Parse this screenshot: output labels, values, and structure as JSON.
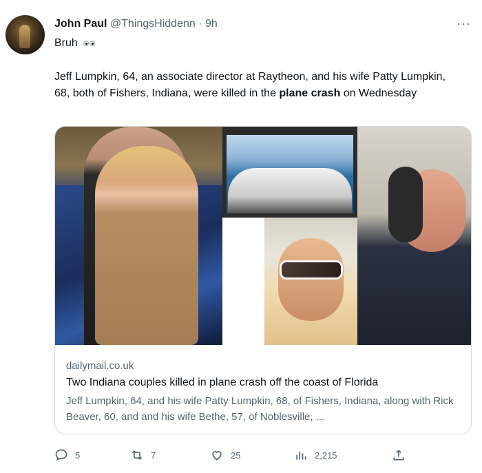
{
  "tweet": {
    "display_name": "John Paul",
    "handle": "@ThingsHiddenn",
    "separator": "·",
    "time": "9h",
    "more": "···",
    "short_text": "Bruh",
    "body_before": "Jeff Lumpkin, 64, an associate director at Raytheon, and his wife Patty Lumpkin, 68, both of Fishers, Indiana, were killed in the ",
    "body_bold": "plane crash",
    "body_after": " on Wednesday"
  },
  "card": {
    "domain": "dailymail.co.uk",
    "title": "Two Indiana couples killed in plane crash off the coast of Florida",
    "description": "Jeff Lumpkin, 64, and his wife Patty Lumpkin, 68, of Fishers, Indiana, along with Rick Beaver, 60, and and his wife Bethe, 57, of Noblesville, ..."
  },
  "actions": {
    "replies": "5",
    "retweets": "7",
    "likes": "25",
    "views": "2,215"
  },
  "icons": {
    "reply": "reply-icon",
    "retweet": "retweet-icon",
    "like": "heart-icon",
    "views": "views-icon",
    "share": "share-icon",
    "eyes": "eyes-emoji-icon"
  },
  "colors": {
    "text": "#0f1419",
    "secondary": "#536471",
    "border": "#cfd9de"
  }
}
